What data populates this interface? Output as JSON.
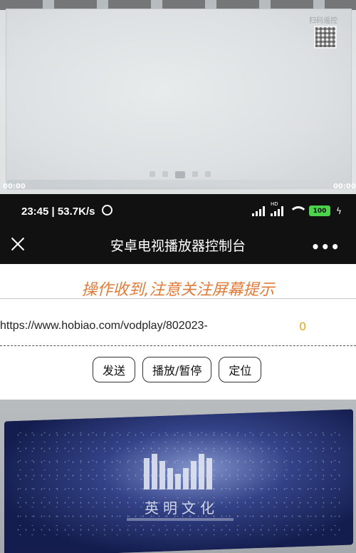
{
  "photo_top": {
    "qr_label": "扫码遥控",
    "time_left": "00:00",
    "time_right": "00:00"
  },
  "status_bar": {
    "time": "23:45",
    "net_speed": "53.7K/s",
    "network_type": "HD",
    "battery": "100"
  },
  "title_bar": {
    "title": "安卓电视播放器控制台",
    "more": "•••"
  },
  "content": {
    "notice": "操作收到,注意关注屏幕提示",
    "url": "https://www.hobiao.com/vodplay/802023-",
    "count": "0",
    "buttons": {
      "send": "发送",
      "play_pause": "播放/暂停",
      "locate": "定位"
    },
    "accent_color": "#e07b39",
    "count_color": "#e6a817"
  },
  "photo_bottom": {
    "brand": "英明文化"
  }
}
